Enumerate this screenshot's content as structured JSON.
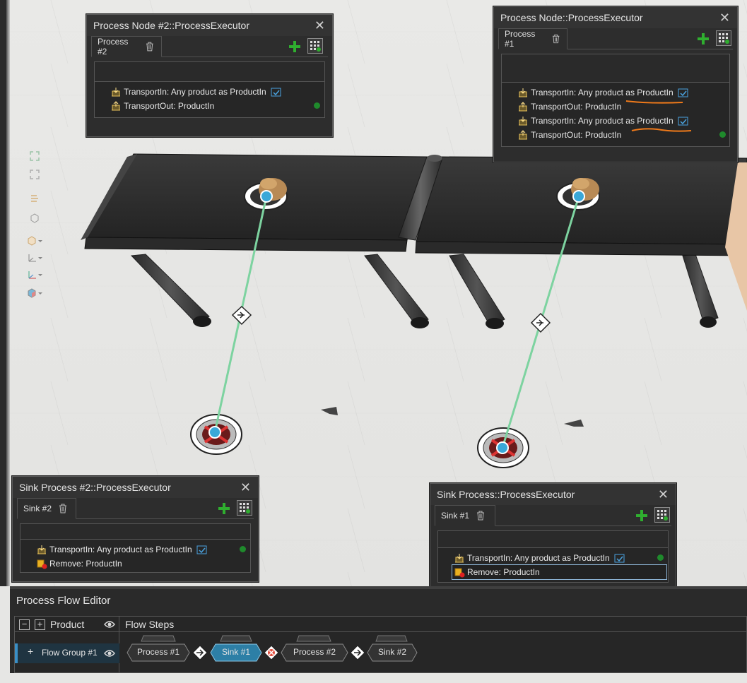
{
  "panels": {
    "process2": {
      "title": "Process Node #2::ProcessExecutor",
      "tab": "Process #2",
      "items": [
        {
          "text": "TransportIn: Any product as ProductIn"
        },
        {
          "text": "TransportOut: ProductIn"
        }
      ]
    },
    "process1": {
      "title": "Process Node::ProcessExecutor",
      "tab": "Process #1",
      "items": [
        {
          "text": "TransportIn: Any product as ProductIn"
        },
        {
          "text": "TransportOut: ProductIn"
        },
        {
          "text": "TransportIn: Any product as ProductIn"
        },
        {
          "text": "TransportOut: ProductIn"
        }
      ]
    },
    "sink2": {
      "title": "Sink Process #2::ProcessExecutor",
      "tab": "Sink #2",
      "items": [
        {
          "text": "TransportIn: Any product as ProductIn"
        },
        {
          "text": "Remove: ProductIn"
        }
      ]
    },
    "sink1": {
      "title": "Sink Process::ProcessExecutor",
      "tab": "Sink #1",
      "items": [
        {
          "text": "TransportIn: Any product as ProductIn"
        },
        {
          "text": "Remove: ProductIn"
        }
      ]
    }
  },
  "flow_editor": {
    "title": "Process Flow Editor",
    "col_product": "Product",
    "col_steps": "Flow Steps",
    "collapse_label": "−",
    "expand_label": "+",
    "group_expand": "+",
    "group_name": "Flow Group #1",
    "steps": [
      "Process #1",
      "Sink #1",
      "Process #2",
      "Sink #2"
    ]
  },
  "icons": {
    "close": "close-icon",
    "trash": "trash-icon",
    "add": "add-icon",
    "grid": "grid-settings-icon",
    "eye": "eye-icon",
    "transport": "transport-in-icon",
    "remove": "remove-icon",
    "checkbox": "checkbox-icon"
  },
  "colors": {
    "accent_blue": "#3aa8d8",
    "flow_line": "#7dd3a0",
    "status_green": "#1f8a2c",
    "add_green": "#2fae2f",
    "highlight_orange": "#f07a1a"
  }
}
